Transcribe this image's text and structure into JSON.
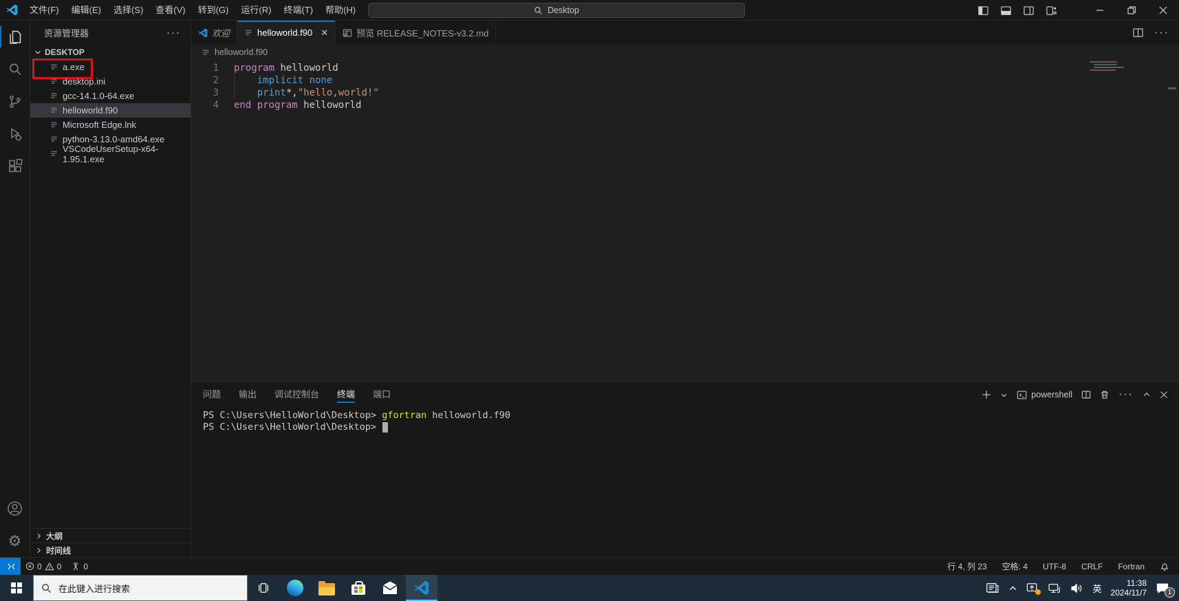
{
  "titlebar": {
    "menus": [
      "文件(F)",
      "编辑(E)",
      "选择(S)",
      "查看(V)",
      "转到(G)",
      "运行(R)",
      "终端(T)",
      "帮助(H)"
    ],
    "search_value": "Desktop"
  },
  "activity_bar": {
    "items": [
      {
        "name": "explorer",
        "active": true
      },
      {
        "name": "search",
        "active": false
      },
      {
        "name": "source-control",
        "active": false
      },
      {
        "name": "run-debug",
        "active": false
      },
      {
        "name": "extensions",
        "active": false
      }
    ]
  },
  "sidebar": {
    "title": "资源管理器",
    "folder": "DESKTOP",
    "files": [
      {
        "label": "a.exe",
        "annotated": true,
        "selected": false
      },
      {
        "label": "desktop.ini",
        "annotated": false,
        "selected": false
      },
      {
        "label": "gcc-14.1.0-64.exe",
        "annotated": false,
        "selected": false
      },
      {
        "label": "helloworld.f90",
        "annotated": false,
        "selected": true
      },
      {
        "label": "Microsoft Edge.lnk",
        "annotated": false,
        "selected": false
      },
      {
        "label": "python-3.13.0-amd64.exe",
        "annotated": false,
        "selected": false
      },
      {
        "label": "VSCodeUserSetup-x64-1.95.1.exe",
        "annotated": false,
        "selected": false
      }
    ],
    "bottom_sections": [
      "大纲",
      "时间线"
    ],
    "annotation_color": "#e01114"
  },
  "editor": {
    "tabs": [
      {
        "label": "欢迎",
        "icon": "vscode",
        "italic": true,
        "active": false,
        "closable": false
      },
      {
        "label": "helloworld.f90",
        "icon": "file",
        "italic": false,
        "active": true,
        "closable": true
      },
      {
        "label": "预览 RELEASE_NOTES-v3.2.md",
        "icon": "preview",
        "italic": false,
        "active": false,
        "closable": false
      }
    ],
    "breadcrumb": "helloworld.f90",
    "token_colors": {
      "keyword": "#C586C0",
      "support": "#569CD6",
      "string": "#CE9178",
      "plain": "#CCCCCC"
    },
    "code_lines": [
      {
        "num": "1",
        "tokens": [
          {
            "c": "keyword",
            "t": "program"
          },
          {
            "c": "plain",
            "t": " helloworld"
          }
        ]
      },
      {
        "num": "2",
        "tokens": [
          {
            "c": "guide",
            "t": ""
          },
          {
            "c": "plain",
            "t": "    "
          },
          {
            "c": "support",
            "t": "implicit none"
          }
        ]
      },
      {
        "num": "3",
        "tokens": [
          {
            "c": "guide",
            "t": ""
          },
          {
            "c": "plain",
            "t": "    "
          },
          {
            "c": "support",
            "t": "print"
          },
          {
            "c": "plain",
            "t": "*,"
          },
          {
            "c": "string",
            "t": "\"hello,world!\""
          }
        ]
      },
      {
        "num": "4",
        "tokens": [
          {
            "c": "keyword",
            "t": "end program"
          },
          {
            "c": "plain",
            "t": " helloworld"
          }
        ]
      }
    ]
  },
  "panel": {
    "tabs": [
      {
        "label": "问题",
        "active": false
      },
      {
        "label": "输出",
        "active": false
      },
      {
        "label": "调试控制台",
        "active": false
      },
      {
        "label": "终端",
        "active": true
      },
      {
        "label": "端口",
        "active": false
      }
    ],
    "shell_label": "powershell",
    "terminal": {
      "lines": [
        {
          "spans": [
            {
              "t": "PS C:\\Users\\HelloWorld\\Desktop> ",
              "color": "#cccccc"
            },
            {
              "t": "gfortran",
              "color": "#e5e510"
            },
            {
              "t": " helloworld.f90",
              "color": "#cccccc"
            }
          ],
          "cursor": false
        },
        {
          "spans": [
            {
              "t": "PS C:\\Users\\HelloWorld\\Desktop> ",
              "color": "#cccccc"
            }
          ],
          "cursor": true
        }
      ]
    }
  },
  "statusbar": {
    "errors": "0",
    "warnings": "0",
    "ports": "0",
    "line_col": "行 4, 列 23",
    "indent": "空格: 4",
    "encoding": "UTF-8",
    "eol": "CRLF",
    "language": "Fortran"
  },
  "taskbar": {
    "search_placeholder": "在此键入进行搜索",
    "ime": "英",
    "time": "11:38",
    "date": "2024/11/7",
    "badge": "1"
  }
}
